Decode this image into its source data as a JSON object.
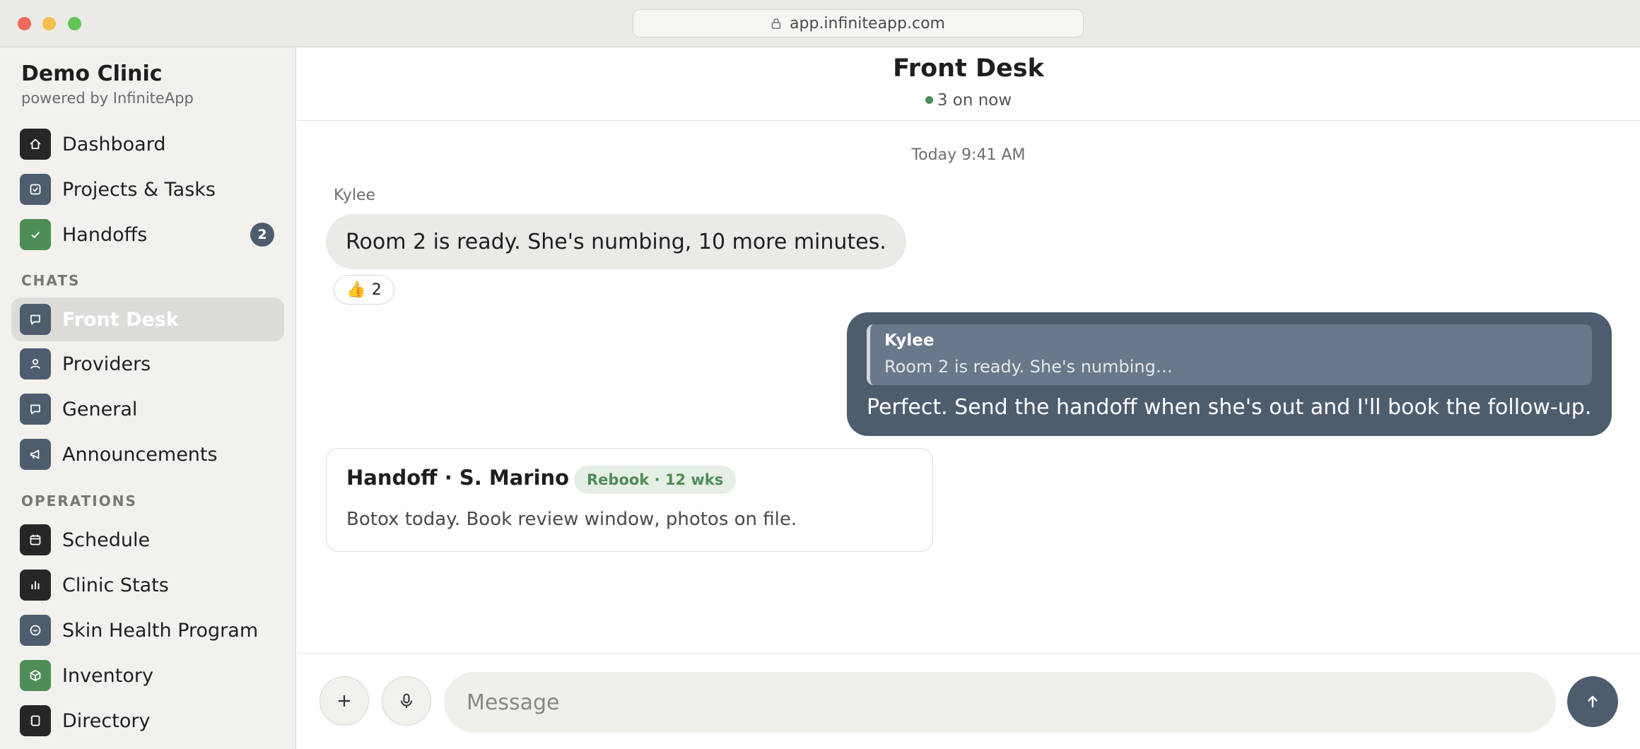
{
  "browser": {
    "url": "app.infiniteapp.com"
  },
  "sidebar": {
    "brand_name": "Demo Clinic",
    "brand_sub": "powered by InfiniteApp",
    "top_items": [
      {
        "label": "Dashboard",
        "icon": "home-icon"
      },
      {
        "label": "Projects & Tasks",
        "icon": "checkbox-icon"
      },
      {
        "label": "Handoffs",
        "icon": "check-icon",
        "badge": "2"
      }
    ],
    "chats_label": "CHATS",
    "chats": [
      {
        "label": "Front Desk",
        "icon": "chat-bubble-icon",
        "active": true
      },
      {
        "label": "Providers",
        "icon": "person-icon"
      },
      {
        "label": "General",
        "icon": "chat-bubble-icon"
      },
      {
        "label": "Announcements",
        "icon": "megaphone-icon"
      }
    ],
    "operations_label": "OPERATIONS",
    "operations": [
      {
        "label": "Schedule",
        "icon": "calendar-icon"
      },
      {
        "label": "Clinic Stats",
        "icon": "bar-chart-icon"
      },
      {
        "label": "Skin Health Program",
        "icon": "smile-icon"
      },
      {
        "label": "Inventory",
        "icon": "box-icon"
      },
      {
        "label": "Directory",
        "icon": "book-icon"
      }
    ]
  },
  "chat": {
    "title": "Front Desk",
    "presence": "3 on now",
    "timestamp": "Today 9:41 AM",
    "messages": [
      {
        "sender": "Kylee",
        "text": "Room 2 is ready. She's numbing, 10 more minutes.",
        "reaction": {
          "emoji": "👍",
          "count": "2"
        }
      },
      {
        "quote_author": "Kylee",
        "quote_text": "Room 2 is ready. She's numbing…",
        "text": "Perfect. Send the handoff when she's out and I'll book the follow-up."
      }
    ],
    "handoff_card": {
      "title": "Handoff · S. Marino",
      "tag": "Rebook · 12 wks",
      "body": "Botox today. Book review window, photos on file."
    }
  },
  "composer": {
    "placeholder": "Message"
  },
  "colors": {
    "accent_slate": "#4e5d6e",
    "accent_green": "#4e8d57",
    "dark_icon": "#262626",
    "sidebar_bg": "#f3f1ee"
  }
}
